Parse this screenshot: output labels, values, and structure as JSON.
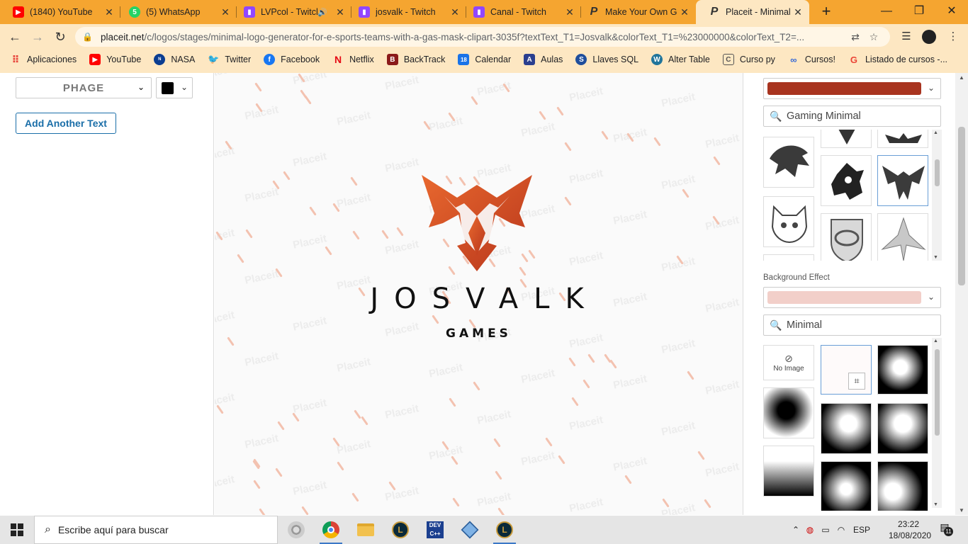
{
  "tabs": [
    {
      "title": "(1840) YouTube",
      "icon": "youtube-icon",
      "color": "#ff0000"
    },
    {
      "title": "(5) WhatsApp",
      "icon": "whatsapp-icon",
      "color": "#25d366"
    },
    {
      "title": "LVPcol - Twitch",
      "icon": "twitch-icon",
      "color": "#9146ff"
    },
    {
      "title": "josvalk - Twitch",
      "icon": "twitch-icon",
      "color": "#9146ff"
    },
    {
      "title": "Canal - Twitch",
      "icon": "twitch-icon",
      "color": "#9146ff"
    },
    {
      "title": "Make Your Own G",
      "icon": "placeit-icon",
      "color": "#333333"
    },
    {
      "title": "Placeit - Minimal L",
      "icon": "placeit-icon",
      "color": "#333333"
    }
  ],
  "address": {
    "host": "placeit.net",
    "path": "/c/logos/stages/minimal-logo-generator-for-e-sports-teams-with-a-gas-mask-clipart-3035f?textText_T1=Josvalk&colorText_T1=%23000000&colorText_T2=..."
  },
  "bookmarks": [
    {
      "label": "Aplicaciones",
      "icon": "apps-grid-icon",
      "color": "#4285f4"
    },
    {
      "label": "YouTube",
      "icon": "youtube-icon",
      "color": "#ff0000"
    },
    {
      "label": "NASA",
      "icon": "nasa-icon",
      "color": "#0b3d91"
    },
    {
      "label": "Twitter",
      "icon": "twitter-icon",
      "color": "#1da1f2"
    },
    {
      "label": "Facebook",
      "icon": "facebook-icon",
      "color": "#1877f2"
    },
    {
      "label": "Netflix",
      "icon": "netflix-icon",
      "color": "#e50914"
    },
    {
      "label": "BackTrack",
      "icon": "backtrack-icon",
      "color": "#8b1a1a"
    },
    {
      "label": "Calendar",
      "icon": "calendar-icon",
      "color": "#1a73e8"
    },
    {
      "label": "Aulas",
      "icon": "aulas-icon",
      "color": "#2a3f8f"
    },
    {
      "label": "Llaves SQL",
      "icon": "sql-icon",
      "color": "#1f4e9c"
    },
    {
      "label": "Alter Table",
      "icon": "wordpress-icon",
      "color": "#21759b"
    },
    {
      "label": "Curso py",
      "icon": "curso-icon",
      "color": "#555555"
    },
    {
      "label": "Cursos!",
      "icon": "link-icon",
      "color": "#3367d6"
    },
    {
      "label": "Listado de cursos -...",
      "icon": "google-icon",
      "color": "#ea4335"
    }
  ],
  "editor": {
    "font_name": "PHAGE",
    "text_color": "#000000",
    "add_text_label": "Add Another Text",
    "logo_text": "JOSVALK",
    "logo_subtext": "GAMES",
    "watermark": "Placeit",
    "logo_color": "#d4502a"
  },
  "right": {
    "graphic_color": "#a8341f",
    "graphic_search": "Gaming Minimal",
    "bg_label": "Background Effect",
    "bg_color": "#f2cfc9",
    "bg_search": "Minimal",
    "no_image_label": "No Image"
  },
  "taskbar": {
    "search_placeholder": "Escribe aquí para buscar",
    "language": "ESP",
    "time": "23:22",
    "date": "18/08/2020",
    "notifications": "11"
  }
}
